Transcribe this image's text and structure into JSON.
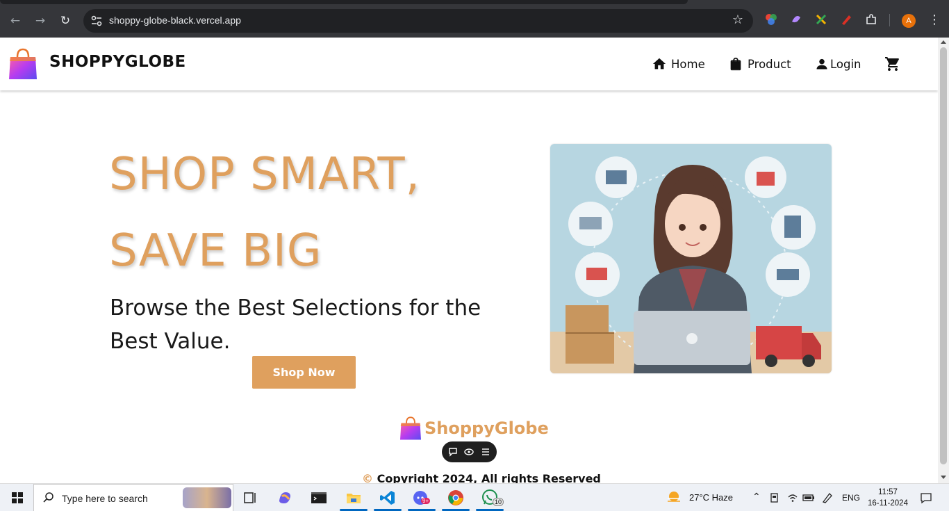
{
  "browser": {
    "url": "shoppy-globe-black.vercel.app",
    "profile_initial": "A"
  },
  "site": {
    "brand": "SHOPPYGLOBE",
    "nav": {
      "home": "Home",
      "product": "Product",
      "login": "Login"
    }
  },
  "hero": {
    "title_line1": "SHOP SMART,",
    "title_line2": "SAVE BIG",
    "subtitle": "Browse the Best Selections for the Best Value.",
    "cta": "Shop Now"
  },
  "footer": {
    "brand": "ShoppyGlobe",
    "copyright_symbol": "©",
    "copyright_text": "Copyright 2024, All rights Reserved"
  },
  "taskbar": {
    "search_placeholder": "Type here to search",
    "weather": "27°C  Haze",
    "language": "ENG",
    "time": "11:57",
    "date": "16-11-2024",
    "whatsapp_badge": "10",
    "copilot_badge": "9+"
  },
  "colors": {
    "accent": "#dfa05e",
    "chrome_bg": "#35363a",
    "omnibox_bg": "#202124"
  }
}
